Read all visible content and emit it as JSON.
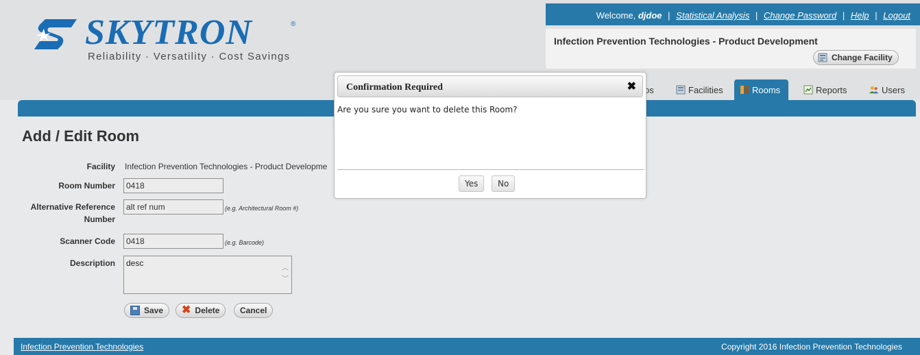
{
  "brand": {
    "name": "SKYTRON",
    "registered": "®",
    "tagline": "Reliability · Versatility · Cost Savings",
    "color": "#1a6cb4"
  },
  "topbar": {
    "welcome_prefix": "Welcome, ",
    "user": "djdoe",
    "links": [
      "Statistical Analysis",
      "Change Password",
      "Help",
      "Logout"
    ],
    "separator": "|"
  },
  "facility": {
    "name": "Infection Prevention Technologies - Product Development",
    "change_label": "Change Facility"
  },
  "tabs": [
    {
      "label": "os",
      "icon": "partial-tab-icon",
      "active": false
    },
    {
      "label": "Facilities",
      "icon": "facility-icon",
      "active": false
    },
    {
      "label": "Rooms",
      "icon": "room-icon",
      "active": true
    },
    {
      "label": "Reports",
      "icon": "report-icon",
      "active": false
    },
    {
      "label": "Users",
      "icon": "users-icon",
      "active": false
    }
  ],
  "page": {
    "title": "Add / Edit Room"
  },
  "form": {
    "facility_label": "Facility",
    "facility_value": "Infection Prevention Technologies - Product Developme",
    "room_number_label": "Room Number",
    "room_number_value": "0418",
    "alt_ref_label_line1": "Alternative Reference",
    "alt_ref_label_line2": "Number",
    "alt_ref_value": "alt ref num",
    "alt_ref_hint": "(e.g. Architectural Room #)",
    "scanner_label": "Scanner Code",
    "scanner_value": "0418",
    "scanner_hint": "(e.g. Barcode)",
    "description_label": "Description",
    "description_value": "desc",
    "save_label": "Save",
    "delete_label": "Delete",
    "cancel_label": "Cancel"
  },
  "modal": {
    "title": "Confirmation Required",
    "message": "Are you sure you want to delete this Room?",
    "yes_label": "Yes",
    "no_label": "No",
    "close_glyph": "✖"
  },
  "footer": {
    "link": "Infection Prevention Technologies",
    "copyright": "Copyright 2016 Infection Prevention Technologies"
  },
  "colors": {
    "primary_blue": "#2679a8",
    "background": "#e8e9ea",
    "delete_red": "#d3451a"
  }
}
